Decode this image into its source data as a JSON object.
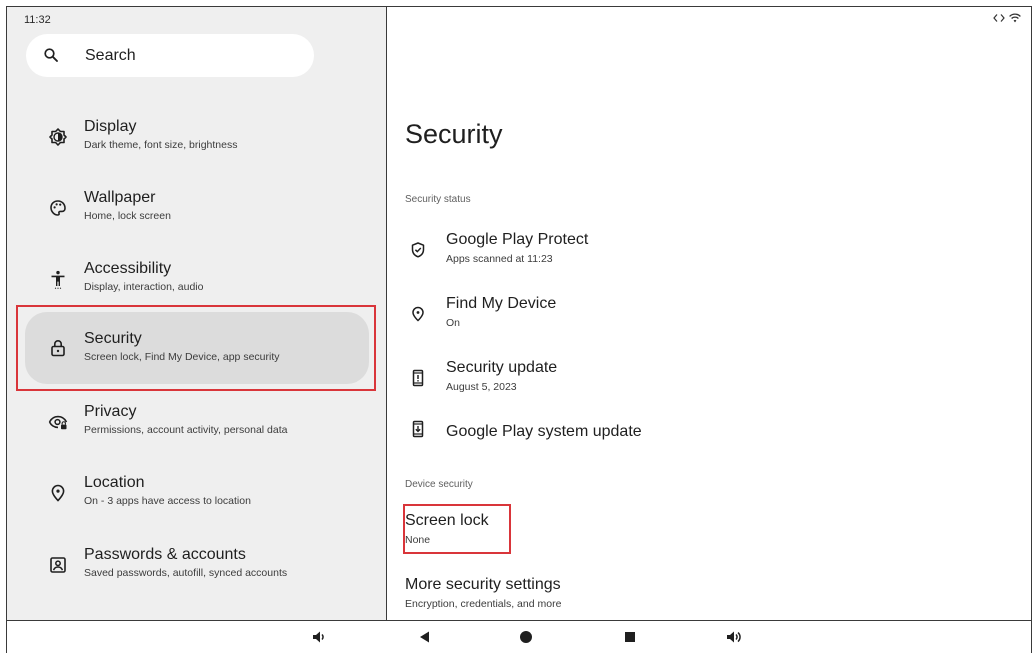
{
  "status_bar": {
    "time": "11:32",
    "icons": [
      "code-icon",
      "wifi-icon"
    ]
  },
  "sidebar": {
    "search_label": "Search",
    "items": [
      {
        "icon": "display-icon",
        "title": "Display",
        "subtitle": "Dark theme, font size, brightness",
        "selected": false
      },
      {
        "icon": "palette-icon",
        "title": "Wallpaper",
        "subtitle": "Home, lock screen",
        "selected": false
      },
      {
        "icon": "accessibility-icon",
        "title": "Accessibility",
        "subtitle": "Display, interaction, audio",
        "selected": false
      },
      {
        "icon": "lock-icon",
        "title": "Security",
        "subtitle": "Screen lock, Find My Device, app security",
        "selected": true
      },
      {
        "icon": "privacy-eye-icon",
        "title": "Privacy",
        "subtitle": "Permissions, account activity, personal data",
        "selected": false
      },
      {
        "icon": "location-pin-icon",
        "title": "Location",
        "subtitle": "On - 3 apps have access to location",
        "selected": false
      },
      {
        "icon": "account-box-icon",
        "title": "Passwords & accounts",
        "subtitle": "Saved passwords, autofill, synced accounts",
        "selected": false
      }
    ]
  },
  "main": {
    "title": "Security",
    "sections": [
      {
        "header": "Security status",
        "items": [
          {
            "icon": "shield-check-icon",
            "title": "Google Play Protect",
            "subtitle": "Apps scanned at 11:23"
          },
          {
            "icon": "location-pin-icon",
            "title": "Find My Device",
            "subtitle": "On"
          },
          {
            "icon": "phone-alert-icon",
            "title": "Security update",
            "subtitle": "August 5, 2023"
          },
          {
            "icon": "phone-download-icon",
            "title": "Google Play system update",
            "subtitle": ""
          }
        ]
      },
      {
        "header": "Device security",
        "items": [
          {
            "icon": "",
            "title": "Screen lock",
            "subtitle": "None"
          },
          {
            "icon": "",
            "title": "More security settings",
            "subtitle": "Encryption, credentials, and more"
          }
        ]
      }
    ]
  },
  "nav_bar": {
    "buttons": [
      "volume-down-icon",
      "back-icon",
      "home-icon",
      "recents-icon",
      "volume-up-icon"
    ]
  },
  "colors": {
    "sidebar_bg": "#efefef",
    "selected_bg": "#dcdcdc",
    "highlight": "#d9353a"
  }
}
